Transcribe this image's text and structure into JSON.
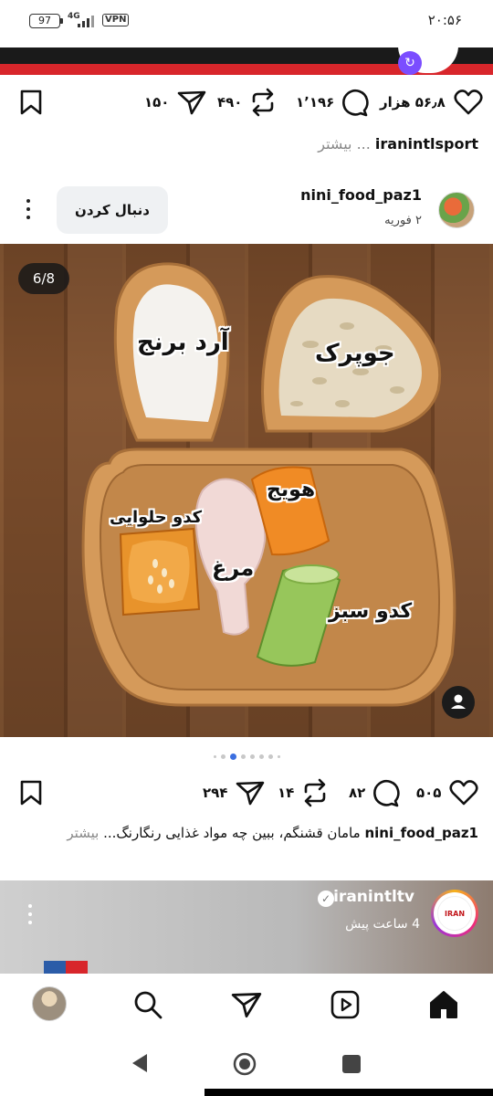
{
  "status_bar": {
    "battery": "97",
    "network": "4G",
    "vpn": "VPN",
    "time": "۲۰:۵۶"
  },
  "prev_post": {
    "likes": "۵۶٫۸ هزار",
    "comments": "۱٬۱۹۶",
    "reposts": "۴۹۰",
    "shares": "۱۵۰",
    "caption_user": "iranintlsport",
    "caption_more": "... بیشتر"
  },
  "post": {
    "username": "nini_food_paz1",
    "date": "۲ فوریه",
    "follow_label": "دنبال کردن",
    "image_counter": "6/8",
    "labels": {
      "rice_flour": "آرد برنج",
      "oats": "جوپرک",
      "carrot": "هویج",
      "pumpkin": "کدو حلوایی",
      "chicken": "مرغ",
      "zucchini": "کدو سبز"
    },
    "likes": "۵۰۵",
    "comments": "۸۲",
    "reposts": "۱۴",
    "shares": "۲۹۴",
    "caption_user": "nini_food_paz1",
    "caption_text": "مامان قشنگم، ببین چه مواد غذایی رنگارنگ...",
    "caption_more": "بیشتر"
  },
  "next_post": {
    "username": "iranintltv",
    "time_ago": "4 ساعت پیش",
    "logo_text": "IRAN"
  },
  "colors": {
    "accent_blue": "#3b6fe0",
    "brand_red": "#d8262b",
    "follow_bg": "#eff1f3"
  },
  "icons": {
    "like": "heart-icon",
    "comment": "comment-icon",
    "repost": "repost-icon",
    "share": "send-icon",
    "save": "bookmark-icon",
    "nav": [
      "home-icon",
      "reels-icon",
      "send-icon",
      "search-icon",
      "profile-avatar"
    ]
  }
}
